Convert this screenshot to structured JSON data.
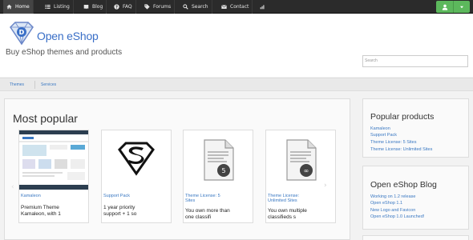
{
  "navbar": {
    "items": [
      {
        "label": "Home",
        "icon": "home-icon"
      },
      {
        "label": "Listing",
        "icon": "list-icon"
      },
      {
        "label": "Blog",
        "icon": "book-icon"
      },
      {
        "label": "FAQ",
        "icon": "question-icon"
      },
      {
        "label": "Forums",
        "icon": "tag-icon"
      },
      {
        "label": "Search",
        "icon": "search-icon"
      },
      {
        "label": "Contact",
        "icon": "envelope-icon"
      }
    ],
    "signin_icons": [
      "user-icon",
      "caret-down-icon"
    ]
  },
  "header": {
    "logo_text": "Open eShop",
    "tagline": "Buy eShop themes and products",
    "search_placeholder": "Search"
  },
  "breadcrumb": [
    "Themes",
    "Services"
  ],
  "main": {
    "title": "Most popular",
    "cards": [
      {
        "title": "Kamaleon",
        "desc_lines": [
          "Premium Theme",
          "Kamaleon, with 1"
        ]
      },
      {
        "title": "Support Pack",
        "desc_lines": [
          "1 year priority",
          "support + 1 so"
        ]
      },
      {
        "title_lines": [
          "Theme License: 5",
          "Sites"
        ],
        "desc_lines": [
          "You own more than",
          "one classifi"
        ]
      },
      {
        "title_lines": [
          "Theme License:",
          "Unlimited Sites"
        ],
        "desc_lines": [
          "You own multiple",
          "classifieds s"
        ]
      }
    ],
    "badges": {
      "five": "5",
      "infinite": "∞"
    }
  },
  "sidebar": {
    "popular_title": "Popular products",
    "popular_links": [
      "Kamaleon",
      "Support Pack",
      "Theme License: 5 Sites",
      "Theme License: Unlimited Sites"
    ],
    "blog_title": "Open eShop Blog",
    "blog_links": [
      "Working on 1.2 release",
      "Open eShop 1.1",
      "New Logo and Favicon",
      "Open eShop 1.0 Launched!"
    ]
  },
  "colors": {
    "link": "#3a78c2",
    "navbar": "#2b2b2b",
    "signin": "#5cb85c"
  }
}
